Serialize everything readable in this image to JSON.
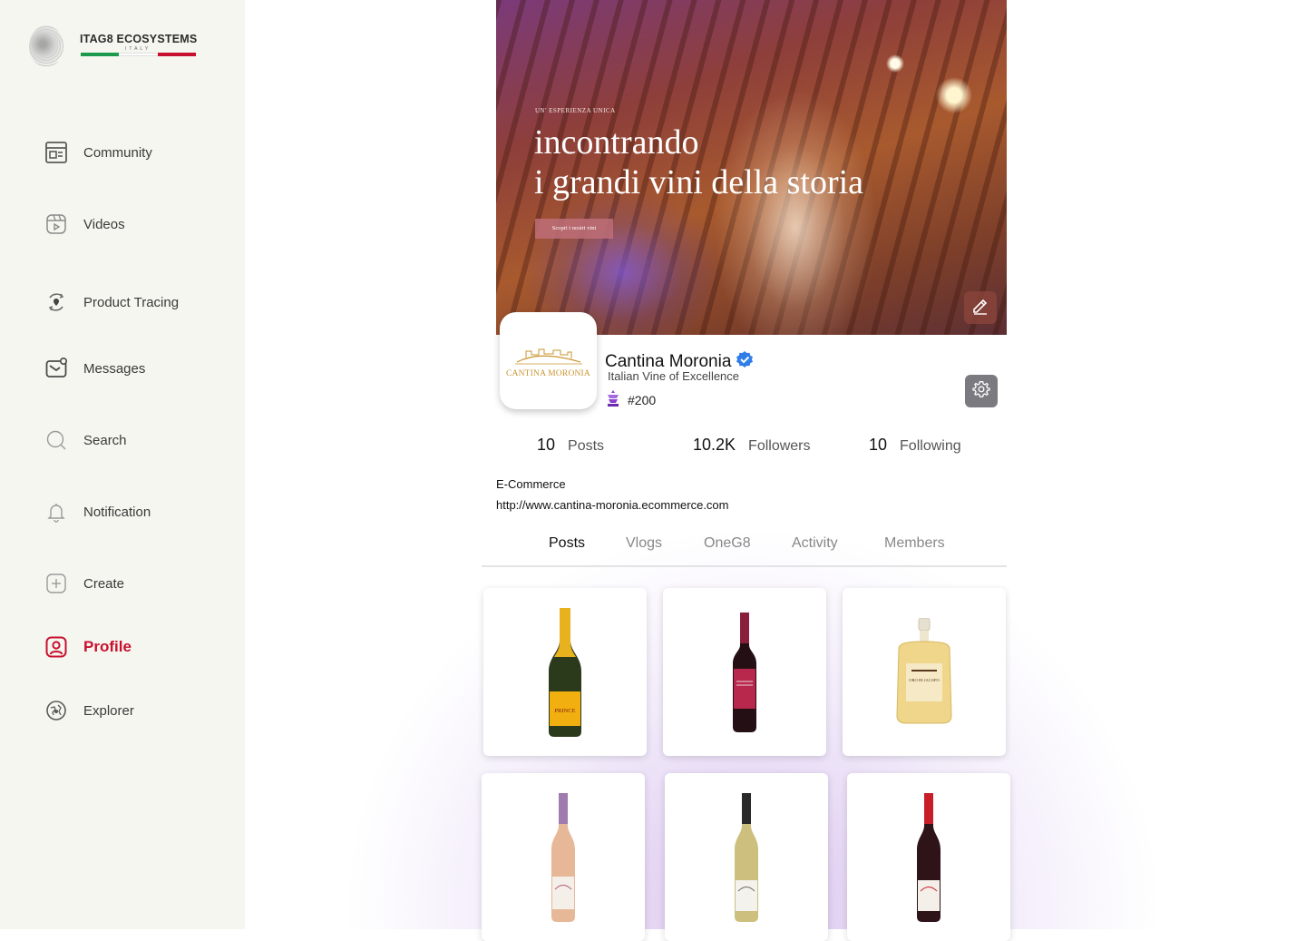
{
  "brand": {
    "name": "ITAG8 ECOSYSTEMS",
    "country": "ITALY",
    "flag_colors": [
      "#1a9a4a",
      "#ffffff",
      "#c8102e"
    ]
  },
  "sidebar": {
    "items": [
      {
        "label": "Community",
        "icon": "community-icon",
        "active": false
      },
      {
        "label": "Videos",
        "icon": "videos-icon",
        "active": false
      },
      {
        "label": "Product Tracing",
        "icon": "product-tracing-icon",
        "active": false
      },
      {
        "label": "Messages",
        "icon": "messages-icon",
        "active": false
      },
      {
        "label": "Search",
        "icon": "search-icon",
        "active": false
      },
      {
        "label": "Notification",
        "icon": "bell-icon",
        "active": false
      },
      {
        "label": "Create",
        "icon": "plus-icon",
        "active": false
      },
      {
        "label": "Profile",
        "icon": "profile-icon",
        "active": true
      },
      {
        "label": "Explorer",
        "icon": "explorer-icon",
        "active": false
      }
    ]
  },
  "cover": {
    "kicker": "UN' ESPERIENZA UNICA",
    "title_line1": "incontrando",
    "title_line2": "i grandi vini della storia",
    "button": "Scopri i nostri vini",
    "edit_icon": "pencil-icon"
  },
  "profile": {
    "avatar_text": "CANTINA MORONIA",
    "name": "Cantina Moronia",
    "verified_icon": "verified-badge-icon",
    "tagline": "Italian Vine of Excellence",
    "rank": "#200",
    "rank_icon": "rank-medal-icon",
    "settings_icon": "gear-icon",
    "category": "E-Commerce",
    "website": "http://www.cantina-moronia.ecommerce.com"
  },
  "stats": {
    "posts": {
      "value": "10",
      "label": "Posts"
    },
    "followers": {
      "value": "10.2K",
      "label": "Followers"
    },
    "following": {
      "value": "10",
      "label": "Following"
    }
  },
  "tabs": [
    {
      "label": "Posts",
      "active": true
    },
    {
      "label": "Vlogs",
      "active": false
    },
    {
      "label": "OneG8",
      "active": false
    },
    {
      "label": "Activity",
      "active": false
    },
    {
      "label": "Members",
      "active": false
    }
  ],
  "posts": [
    {
      "product": "sparkling-wine",
      "label": "PRINCE",
      "body": "#2c3a1c",
      "neck": "#e8b21e",
      "label_color": "#f2b010"
    },
    {
      "product": "red-wine",
      "label": "",
      "body": "#241014",
      "neck": "#8a1f3c",
      "label_color": "#b8284c"
    },
    {
      "product": "golden-liqueur",
      "label": "ORO DI JACOPO",
      "body": "#f0d68a",
      "neck": "#e6e0d0",
      "label_color": "#f6ecd0"
    },
    {
      "product": "rose-wine",
      "label": "",
      "body": "#e7b898",
      "neck": "#a07bb0",
      "label_color": "#f4efe8"
    },
    {
      "product": "white-wine",
      "label": "",
      "body": "#cdbf7e",
      "neck": "#2a2a2a",
      "label_color": "#f4f2ec"
    },
    {
      "product": "red-wine-bottle",
      "label": "",
      "body": "#2e1418",
      "neck": "#c81e28",
      "label_color": "#f4efe8"
    }
  ]
}
